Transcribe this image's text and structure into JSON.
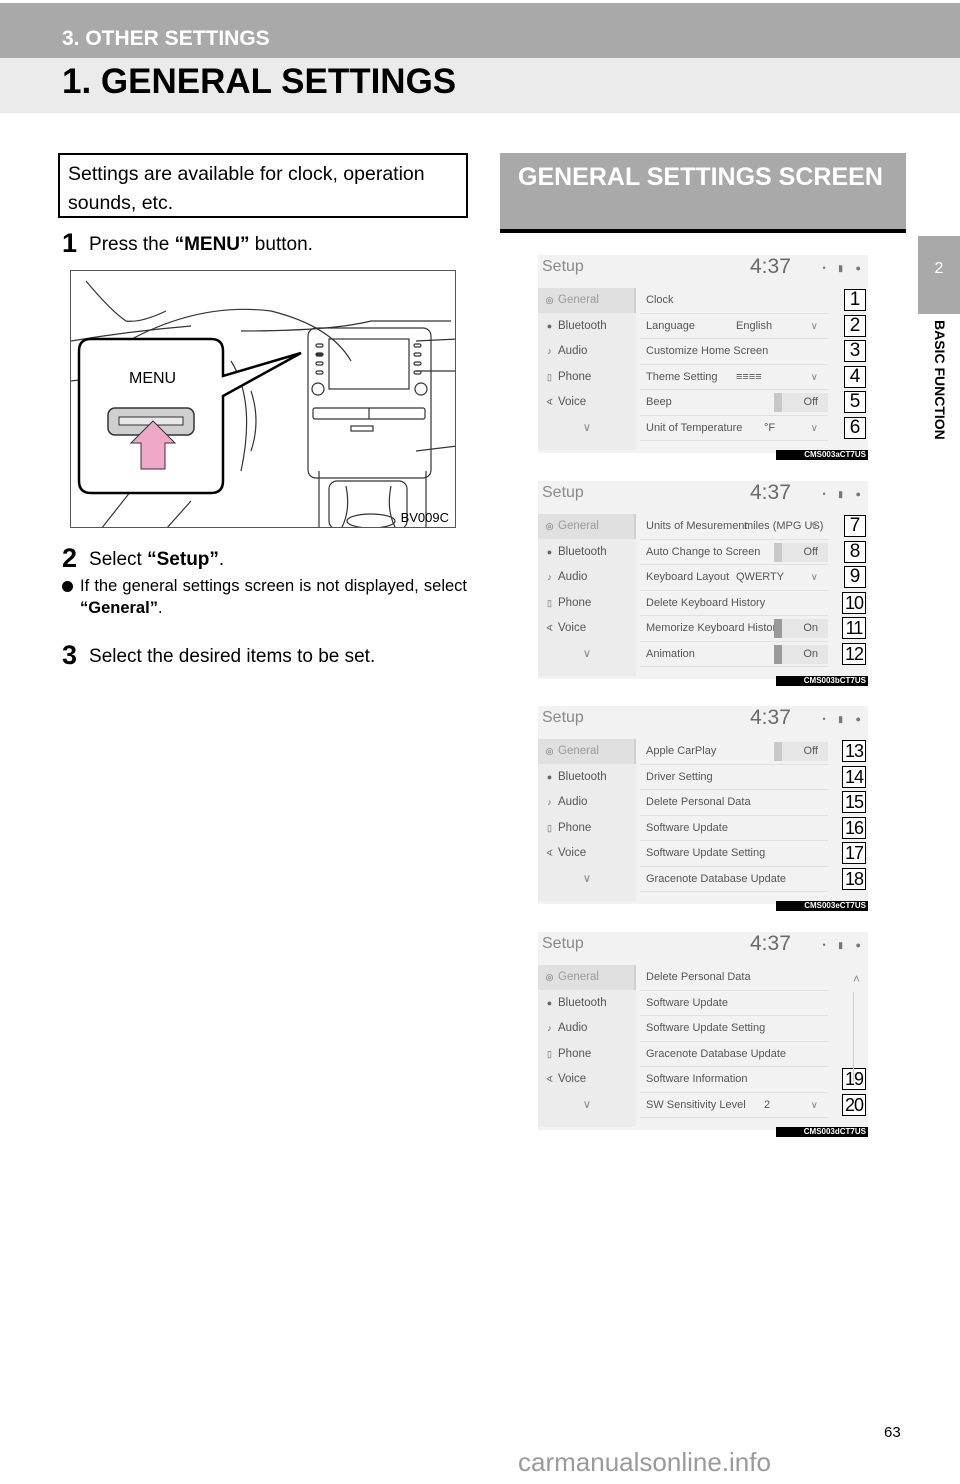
{
  "header": {
    "section": "3. OTHER SETTINGS",
    "title": "1. GENERAL SETTINGS"
  },
  "side_tab": {
    "chapter_number": "2",
    "chapter_label": "BASIC FUNCTION"
  },
  "intro": "Settings are available for clock, operation sounds, etc.",
  "steps": [
    {
      "num": "1",
      "pre": "Press the ",
      "bold": "“MENU”",
      "post": " button."
    },
    {
      "num": "2",
      "pre": "Select ",
      "bold": "“Setup”",
      "post": "."
    },
    {
      "num": "3",
      "pre": "Select the desired items to be set.",
      "bold": "",
      "post": ""
    }
  ],
  "bullet": {
    "pre": "If the general settings screen is not displayed, select ",
    "bold": "“General”",
    "post": "."
  },
  "illustration": {
    "button_label": "MENU",
    "code": "BV009C"
  },
  "gs_header": "GENERAL SETTINGS SCREEN",
  "screens": [
    {
      "title": "Setup",
      "time": "4:37",
      "status": "• ▮ ●",
      "sidebar": [
        "General",
        "Bluetooth",
        "Audio",
        "Phone",
        "Voice"
      ],
      "rows": [
        {
          "label": "Clock",
          "value": "",
          "type": "plain",
          "callout": "1"
        },
        {
          "label": "Language",
          "value": "English",
          "type": "select",
          "callout": "2"
        },
        {
          "label": "Customize Home Screen",
          "value": "",
          "type": "plain",
          "callout": "3"
        },
        {
          "label": "Theme Setting",
          "value": "≡≡≡≡",
          "type": "select",
          "callout": "4"
        },
        {
          "label": "Beep",
          "value": "Off",
          "type": "toggle",
          "callout": "5"
        },
        {
          "label": "Unit of Temperature",
          "value": "°F",
          "type": "select",
          "callout": "6"
        }
      ],
      "code": "CMS003aCT7US"
    },
    {
      "title": "Setup",
      "time": "4:37",
      "status": "• ▮ ●",
      "sidebar": [
        "General",
        "Bluetooth",
        "Audio",
        "Phone",
        "Voice"
      ],
      "rows": [
        {
          "label": "Units of Mesurement",
          "value": "miles (MPG US)",
          "type": "select",
          "callout": "7"
        },
        {
          "label": "Auto Change to Screen",
          "value": "Off",
          "type": "toggle",
          "callout": "8"
        },
        {
          "label": "Keyboard Layout",
          "value": "QWERTY",
          "type": "select",
          "callout": "9"
        },
        {
          "label": "Delete Keyboard History",
          "value": "",
          "type": "plain",
          "callout": "10"
        },
        {
          "label": "Memorize Keyboard History",
          "value": "On",
          "type": "toggle-on",
          "callout": "11"
        },
        {
          "label": "Animation",
          "value": "On",
          "type": "toggle-on",
          "callout": "12"
        }
      ],
      "code": "CMS003bCT7US"
    },
    {
      "title": "Setup",
      "time": "4:37",
      "status": "• ▮ ●",
      "sidebar": [
        "General",
        "Bluetooth",
        "Audio",
        "Phone",
        "Voice"
      ],
      "rows": [
        {
          "label": "Apple CarPlay",
          "value": "Off",
          "type": "toggle",
          "callout": "13"
        },
        {
          "label": "Driver Setting",
          "value": "",
          "type": "plain",
          "callout": "14"
        },
        {
          "label": "Delete Personal Data",
          "value": "",
          "type": "plain",
          "callout": "15"
        },
        {
          "label": "Software Update",
          "value": "",
          "type": "plain",
          "callout": "16"
        },
        {
          "label": "Software Update Setting",
          "value": "",
          "type": "plain",
          "callout": "17"
        },
        {
          "label": "Gracenote Database Update",
          "value": "",
          "type": "plain",
          "callout": "18"
        }
      ],
      "code": "CMS003eCT7US"
    },
    {
      "title": "Setup",
      "time": "4:37",
      "status": "• ▮ ●",
      "sidebar": [
        "General",
        "Bluetooth",
        "Audio",
        "Phone",
        "Voice"
      ],
      "rows": [
        {
          "label": "Delete Personal Data",
          "value": "",
          "type": "plain",
          "callout": ""
        },
        {
          "label": "Software Update",
          "value": "",
          "type": "plain",
          "callout": ""
        },
        {
          "label": "Software Update Setting",
          "value": "",
          "type": "plain",
          "callout": ""
        },
        {
          "label": "Gracenote Database Update",
          "value": "",
          "type": "plain",
          "callout": ""
        },
        {
          "label": "Software Information",
          "value": "",
          "type": "plain",
          "callout": "19"
        },
        {
          "label": "SW Sensitivity Level",
          "value": "2",
          "type": "select",
          "callout": "20"
        }
      ],
      "scroll_up": true,
      "code": "CMS003dCT7US"
    }
  ],
  "page_number": "63",
  "watermark": "carmanualsonline.info"
}
